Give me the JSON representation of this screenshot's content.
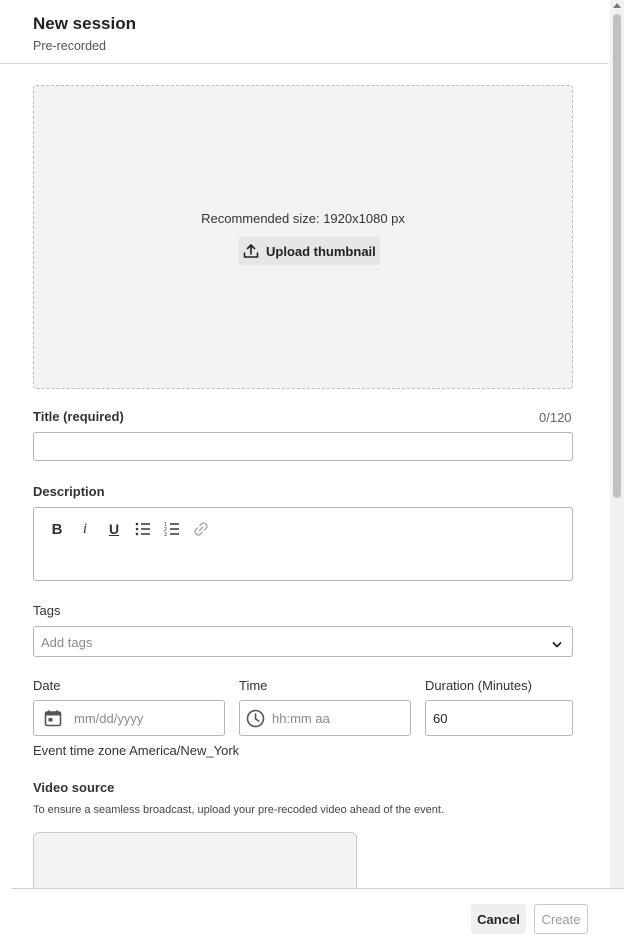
{
  "header": {
    "title": "New session",
    "subtitle": "Pre-recorded"
  },
  "thumbnail": {
    "recommended": "Recommended size: 1920x1080 px",
    "upload_label": "Upload thumbnail"
  },
  "title_field": {
    "label": "Title (required)",
    "counter": "0/120",
    "value": ""
  },
  "description": {
    "label": "Description",
    "toolbar": [
      "bold-icon",
      "italic-icon",
      "underline-icon",
      "bullet-list-icon",
      "numbered-list-icon",
      "link-icon"
    ]
  },
  "tags": {
    "label": "Tags",
    "placeholder": "Add tags"
  },
  "date": {
    "label": "Date",
    "placeholder": "mm/dd/yyyy"
  },
  "time": {
    "label": "Time",
    "placeholder": "hh:mm aa"
  },
  "duration": {
    "label": "Duration (Minutes)",
    "value": "60"
  },
  "timezone_note": "Event time zone America/New_York",
  "video_source": {
    "label": "Video source",
    "note": "To ensure a seamless broadcast, upload your pre-recoded video ahead of the event."
  },
  "footer": {
    "cancel_label": "Cancel",
    "create_label": "Create"
  },
  "colors": {
    "dropzone_bg": "#f3f3f3",
    "border": "#b5b5b5",
    "text": "#222222",
    "disabled_text": "#9a9a9a"
  }
}
